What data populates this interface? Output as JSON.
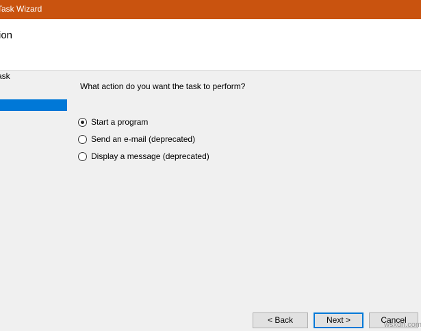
{
  "window": {
    "title": "Task Wizard"
  },
  "header": {
    "title": "ion"
  },
  "nav": {
    "items": [
      {
        "label": "Task"
      },
      {
        "label": ""
      }
    ]
  },
  "main": {
    "question": "What action do you want the task to perform?",
    "options": [
      {
        "label": "Start a program",
        "checked": true
      },
      {
        "label": "Send an e-mail (deprecated)",
        "checked": false
      },
      {
        "label": "Display a message (deprecated)",
        "checked": false
      }
    ]
  },
  "footer": {
    "back_label": "< Back",
    "next_label": "Next >",
    "cancel_label": "Cancel"
  },
  "watermark": {
    "text": "wsxdn.com"
  },
  "colors": {
    "titlebar": "#c9530f",
    "selection": "#0078d7",
    "panel_bg": "#f0f0f0",
    "header_bg": "#ffffff"
  }
}
